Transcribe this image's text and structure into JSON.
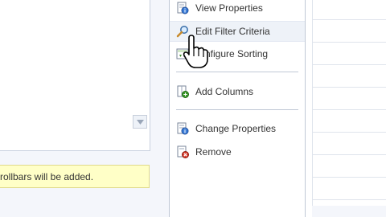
{
  "info_bar": {
    "text": "rollbars will be added."
  },
  "menu": {
    "items": [
      {
        "label": "View Properties",
        "icon": "view-properties-icon"
      },
      {
        "label": "Edit Filter Criteria",
        "icon": "magnifier-icon"
      },
      {
        "label": "nfigure Sorting",
        "icon": "sorting-icon"
      },
      {
        "label": "Add Columns",
        "icon": "add-columns-icon"
      },
      {
        "label": "Change Properties",
        "icon": "change-properties-icon"
      },
      {
        "label": "Remove",
        "icon": "remove-icon"
      }
    ]
  },
  "colors": {
    "info_bar_bg": "#ffffc7",
    "menu_border": "#c0c8d6",
    "highlight": "#eef2f8"
  }
}
